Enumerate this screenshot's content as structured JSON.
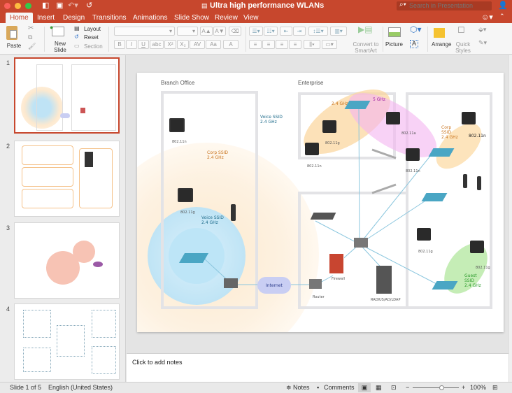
{
  "window": {
    "title": "Ultra high performance WLANs",
    "search_placeholder": "Search in Presentation"
  },
  "tabs": [
    {
      "label": "Home",
      "active": true
    },
    {
      "label": "Insert"
    },
    {
      "label": "Design"
    },
    {
      "label": "Transitions"
    },
    {
      "label": "Animations"
    },
    {
      "label": "Slide Show"
    },
    {
      "label": "Review"
    },
    {
      "label": "View"
    }
  ],
  "ribbon": {
    "paste": "Paste",
    "new_slide": "New Slide",
    "layout": "Layout",
    "reset": "Reset",
    "section": "Section",
    "font_name": "",
    "font_size": "",
    "bold": "B",
    "italic": "I",
    "underline": "U",
    "strikethrough": "abc",
    "superscript": "X²",
    "subscript": "X₂",
    "char_spacing": "AV",
    "change_case": "Aa",
    "font_color": "A",
    "grow_font": "A▲",
    "shrink_font": "A▼",
    "convert_smartart": "Convert to SmartArt",
    "picture": "Picture",
    "arrange": "Arrange",
    "quick_styles": "Quick Styles"
  },
  "slides_panel": {
    "slides": [
      {
        "number": "1",
        "selected": true
      },
      {
        "number": "2"
      },
      {
        "number": "3"
      },
      {
        "number": "4"
      }
    ]
  },
  "slide": {
    "branch_title": "Branch Office",
    "enterprise_title": "Enterprise",
    "voice_ssid_top": "Voice SSID\n2.4 GHz",
    "corp_ssid_branch": "Corp SSID\n2.4 GHz",
    "voice_ssid_branch": "Voice SSID\n2.4 GHz",
    "internet": "Internet",
    "band_24": "2.4 GHz",
    "band_5": "5 GHz",
    "corp_ssid_ent": "Corp\nSSID\n2.4 GHz",
    "guest_ssid": "Guest\nSSID\n2.4 GHz",
    "firewall": "Firewall",
    "router": "Router",
    "radius": "RADIUS/AD/LDAP",
    "laptop_labels": {
      "branch_top": "802.11n",
      "branch_mid": "802.11g",
      "ent_g": "802.11g",
      "ent_n_left": "802.11n",
      "ent_a": "802.11a",
      "ent_n_mid": "802.11n",
      "ent_n_right": "802.11n",
      "ent_g_right": "802.11g",
      "ent_g_bottom": "802.11g"
    },
    "colors": {
      "corp": "#f7b46a",
      "voice": "#8fd0ee",
      "five_ghz": "#f3a6f0",
      "guest": "#8fdc74",
      "ap": "#4aa6c4",
      "link": "#8ac6de"
    }
  },
  "notes_placeholder": "Click to add notes",
  "status": {
    "slide_info": "Slide 1 of 5",
    "language": "English (United States)",
    "notes": "Notes",
    "comments": "Comments",
    "zoom": "100%",
    "zoom_level": 1.0
  }
}
